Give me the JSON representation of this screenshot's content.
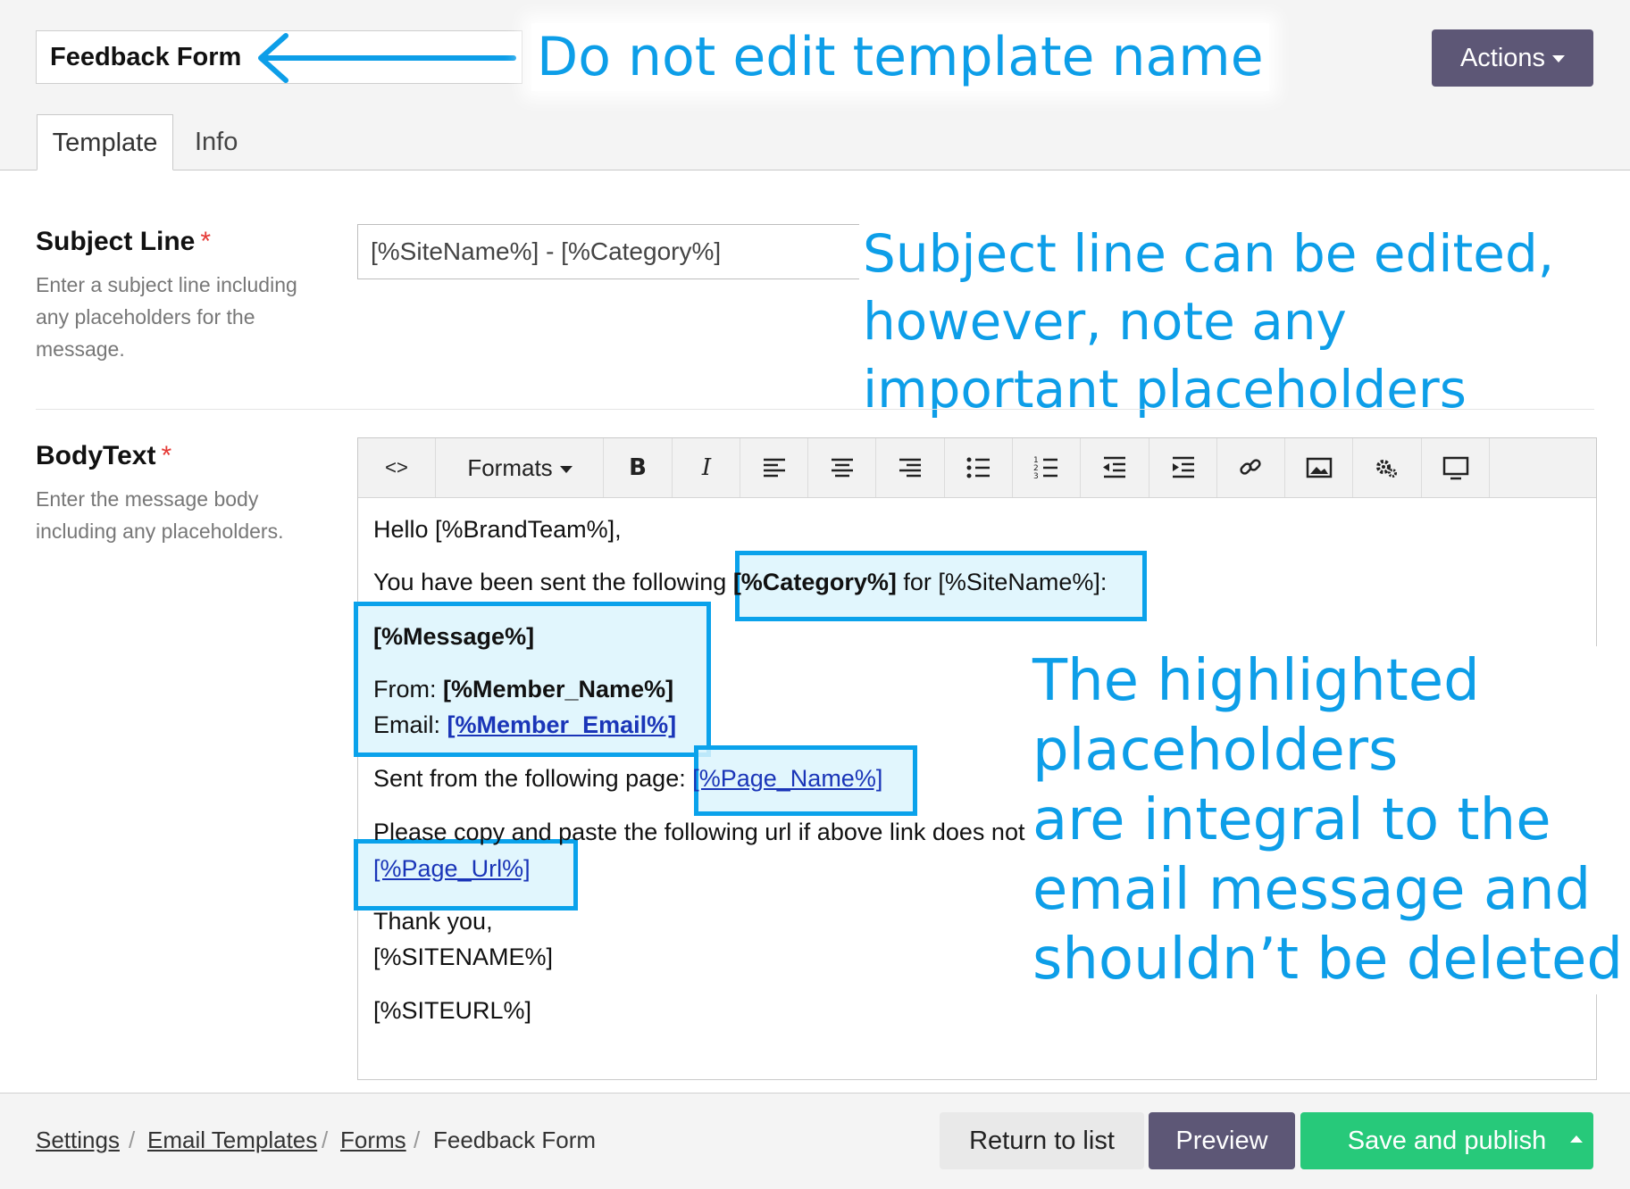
{
  "header": {
    "template_name": "Feedback Form",
    "actions_label": "Actions",
    "tabs": [
      {
        "label": "Template"
      },
      {
        "label": "Info"
      }
    ]
  },
  "fields": {
    "subject": {
      "label": "Subject Line",
      "required_mark": "*",
      "help_lines": [
        "Enter a subject line including",
        "any placeholders for the",
        "message."
      ],
      "value": "[%SiteName%] - [%Category%]"
    },
    "body": {
      "label": "BodyText",
      "required_mark": "*",
      "help_lines": [
        "Enter the message body",
        "including any placeholders."
      ]
    }
  },
  "toolbar": {
    "source_icon": "<>",
    "formats_label": "Formats",
    "items": [
      "source-code",
      "formats",
      "bold",
      "italic",
      "align-left",
      "align-center",
      "align-right",
      "bullet-list",
      "numbered-list",
      "outdent",
      "indent",
      "link",
      "image",
      "settings",
      "preview"
    ]
  },
  "email_body": {
    "greeting": "Hello [%BrandTeam%],",
    "intro_prefix": "You have been sent the following ",
    "intro_category": "[%Category%]",
    "intro_suffix": " for [%SiteName%]:",
    "message": "[%Message%]",
    "from_label": "From: ",
    "from_value": "[%Member_Name%]",
    "email_label": "Email: ",
    "email_value": "[%Member_Email%]",
    "page_prefix": "Sent from the following page: ",
    "page_name": "[%Page_Name%]",
    "copy_text": "Please copy and paste the following url if above link does not work:",
    "page_url": "[%Page_Url%]",
    "thanks": "Thank you,",
    "sitename": "[%SITENAME%]",
    "siteurl": "[%SITEURL%]"
  },
  "annotations": {
    "name_note": "Do not edit template name",
    "subject_note": [
      "Subject line can be edited,",
      "however, note any",
      "important placeholders"
    ],
    "placeholder_note": [
      "The highlighted",
      "placeholders",
      "are integral to the",
      "email message and",
      "shouldn’t be deleted"
    ]
  },
  "footer": {
    "breadcrumb": [
      "Settings",
      "Email Templates",
      "Forms",
      "Feedback Form"
    ],
    "separator": "/",
    "return_label": "Return to list",
    "preview_label": "Preview",
    "save_label": "Save and publish"
  },
  "colors": {
    "annotation": "#0d9ee8",
    "highlight_border": "#0aa2eb",
    "highlight_fill": "#dcf4fd",
    "primary_button": "#5d5776",
    "save_button": "#27c97a",
    "required": "#e53935"
  }
}
